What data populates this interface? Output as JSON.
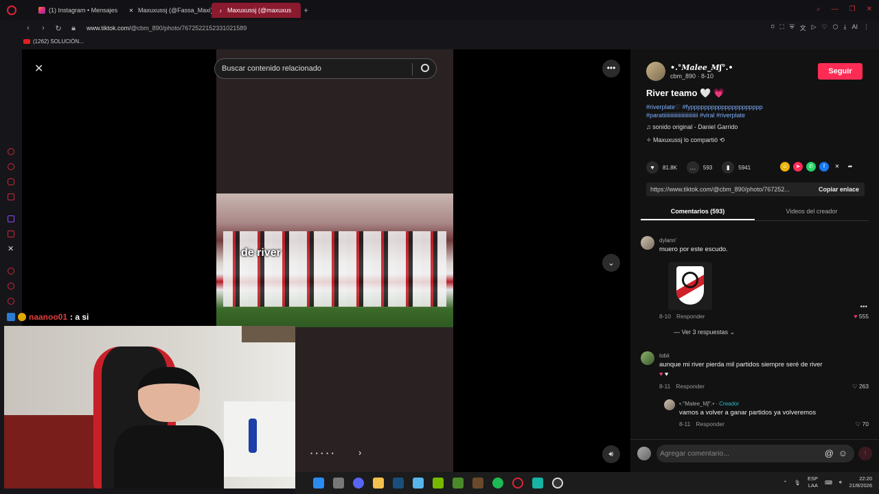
{
  "browser": {
    "tabs": [
      {
        "label": "(1) Instagram • Mensajes",
        "icon": "instagram-icon",
        "active": false
      },
      {
        "label": "Maxuxussj (@Fassa_Maxi)",
        "icon": "x-icon",
        "active": false
      },
      {
        "label": "Maxuxussj (@maxuxus",
        "icon": "tiktok-icon",
        "active": true
      }
    ],
    "url_prefix": "www.tiktok.com/",
    "url_path": "@cbm_890/photo/7672522152331021589",
    "bookmark": "(1262) SOLUCIÓN..."
  },
  "viewer": {
    "search_placeholder": "Buscar contenido relacionado",
    "overlay_text": "de river",
    "more_label": "•••",
    "dots": "• • • • •"
  },
  "chat": {
    "user": "naanoo01",
    "message": ": a si"
  },
  "post": {
    "author_name": "•.°Malee_Mʃ°.•",
    "author_handle": "cbm_890 · 8-10",
    "follow_label": "Seguir",
    "title": "River teamo",
    "title_hearts": [
      "🤍",
      "💗"
    ],
    "tags_line1": "#riverplate♡ #fyppppppppppppppppppppp",
    "tags_line2": "#paratiiiiiiiiiiiiiiiiiiiiiiiii #viral #riverplate",
    "sound": "sonido original - Daniel Garrido",
    "shared": "Maxuxussj lo compartió",
    "likes": "81.8K",
    "comments": "593",
    "saves": "5941",
    "link": "https://www.tiktok.com/@cbm_890/photo/767252...",
    "copy_link": "Copiar enlace",
    "tab_comments": "Comentarios (593)",
    "tab_videos": "Videos del creador"
  },
  "comments": [
    {
      "user": "dylann'",
      "text": "muero por este escudo.",
      "date": "8-10",
      "reply": "Responder",
      "likes": "555",
      "view_replies": "Ver 3 respuestas"
    },
    {
      "user": "tobii",
      "text": "aunque mi river pierda mil partidos siempre seré de river",
      "date": "8-11",
      "reply": "Responder",
      "likes": "263"
    },
    {
      "user": "•.°Malee_Mʃ°.•",
      "creator_tag": "· Creador",
      "text": "vamos a volver a ganar partidos ya volveremos",
      "date": "8-11",
      "reply": "Responder",
      "likes": "70"
    }
  ],
  "add_comment_placeholder": "Agregar comentario...",
  "taskbar": {
    "lang_top": "ESP",
    "lang_bottom": "LAA",
    "time": "22:20",
    "date": "21/8/2026"
  },
  "colors": {
    "follow": "#fe2c55",
    "tags": "#7fb0ff",
    "creator": "#2fbcd0",
    "opera": "#d2263a"
  }
}
